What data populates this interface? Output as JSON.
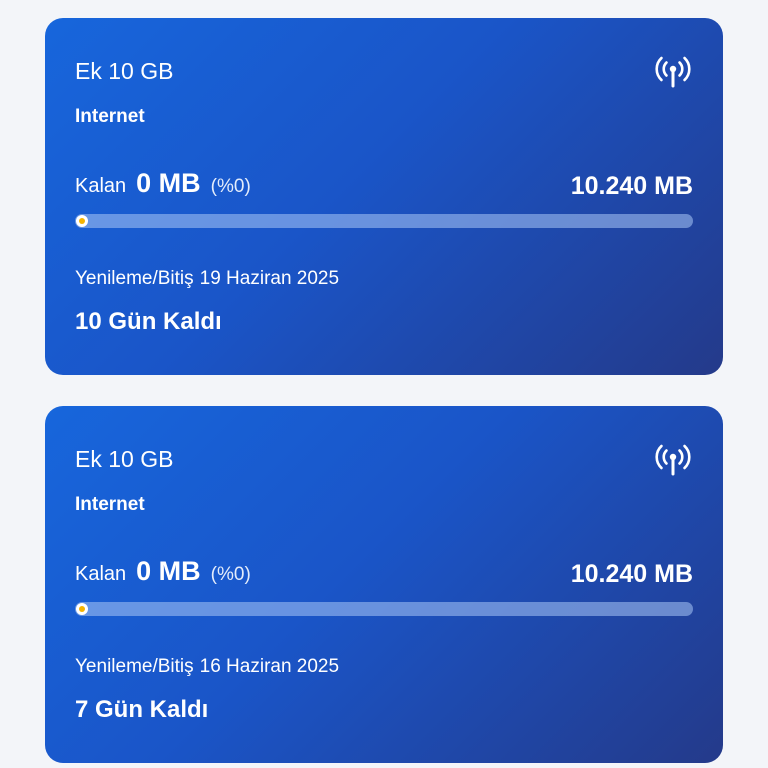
{
  "colors": {
    "page_background": "#f3f5f9",
    "card_gradient_start": "#1766dc",
    "card_gradient_end": "#243a8a",
    "progress_track": "#aac6f5",
    "knob_accent": "#f5b400"
  },
  "packages": [
    {
      "name": "Ek 10 GB",
      "type": "Internet",
      "icon": "signal-tower-icon",
      "remaining_label": "Kalan",
      "remaining_value": "0 MB",
      "remaining_percent": "(%0)",
      "total": "10.240 MB",
      "usage_remaining_fraction": 0,
      "renewal_label": "Yenileme/Bitiş",
      "renewal_date": "19 Haziran 2025",
      "days_left": "10 Gün Kaldı"
    },
    {
      "name": "Ek 10 GB",
      "type": "Internet",
      "icon": "signal-tower-icon",
      "remaining_label": "Kalan",
      "remaining_value": "0 MB",
      "remaining_percent": "(%0)",
      "total": "10.240 MB",
      "usage_remaining_fraction": 0,
      "renewal_label": "Yenileme/Bitiş",
      "renewal_date": "16 Haziran 2025",
      "days_left": "7 Gün Kaldı"
    }
  ]
}
